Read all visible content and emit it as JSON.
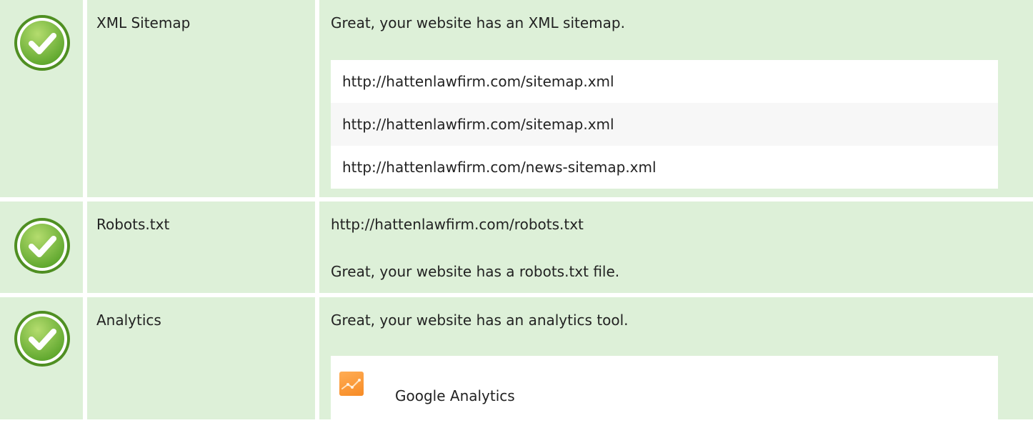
{
  "rows": [
    {
      "name": "XML Sitemap",
      "status_icon": "check-icon",
      "message": "Great, your website has an XML sitemap.",
      "urls": [
        "http://hattenlawfirm.com/sitemap.xml",
        "http://hattenlawfirm.com/sitemap.xml",
        "http://hattenlawfirm.com/news-sitemap.xml"
      ]
    },
    {
      "name": "Robots.txt",
      "status_icon": "check-icon",
      "url": "http://hattenlawfirm.com/robots.txt",
      "message": "Great, your website has a robots.txt file."
    },
    {
      "name": "Analytics",
      "status_icon": "check-icon",
      "message": "Great, your website has an analytics tool.",
      "tool": {
        "icon": "google-analytics-icon",
        "label": "Google Analytics"
      }
    }
  ],
  "colors": {
    "row_background": "#ddf0d8",
    "check_green": "#7ac043",
    "tool_icon_orange": "#f7922e"
  }
}
